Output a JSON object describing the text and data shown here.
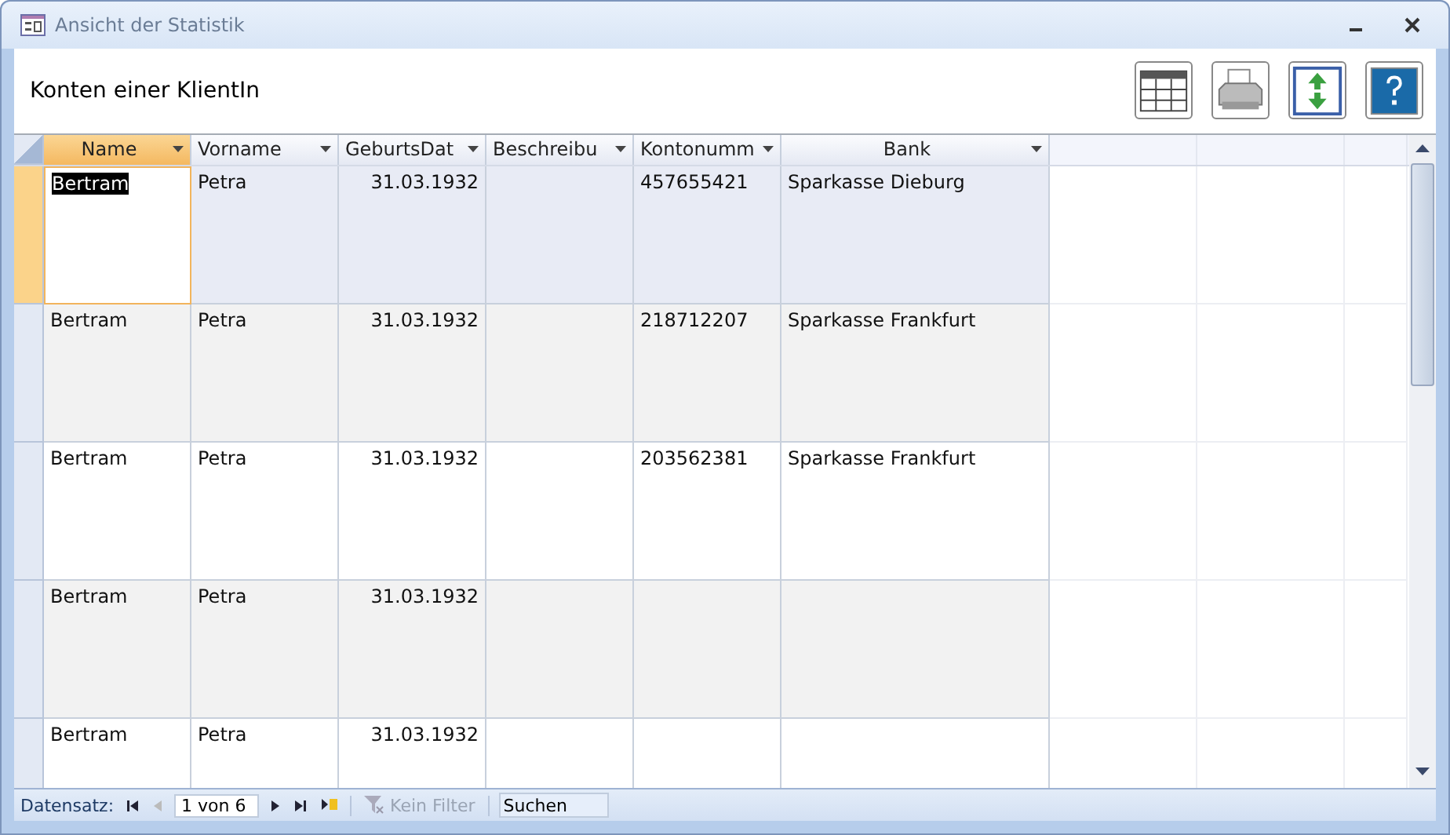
{
  "window": {
    "title": "Ansicht der Statistik"
  },
  "form_title": "Konten einer KlientIn",
  "toolbar": [
    {
      "kind": "table"
    },
    {
      "kind": "print"
    },
    {
      "kind": "updown"
    },
    {
      "kind": "help"
    }
  ],
  "table": {
    "columns": [
      {
        "label": "Name",
        "selected": true,
        "kind": "text"
      },
      {
        "label": "Vorname",
        "selected": false,
        "kind": "text"
      },
      {
        "label": "GeburtsDat",
        "selected": false,
        "kind": "date"
      },
      {
        "label": "Beschreibu",
        "selected": false,
        "kind": "text"
      },
      {
        "label": "Kontonumm",
        "selected": false,
        "kind": "text"
      },
      {
        "label": "Bank",
        "selected": false,
        "kind": "text"
      }
    ],
    "rows": [
      {
        "selected": true,
        "cells": [
          "Bertram",
          "Petra",
          "31.03.1932",
          "",
          "457655421",
          "Sparkasse Dieburg"
        ]
      },
      {
        "selected": false,
        "cells": [
          "Bertram",
          "Petra",
          "31.03.1932",
          "",
          "218712207",
          "Sparkasse Frankfurt"
        ]
      },
      {
        "selected": false,
        "cells": [
          "Bertram",
          "Petra",
          "31.03.1932",
          "",
          "203562381",
          "Sparkasse Frankfurt"
        ]
      },
      {
        "selected": false,
        "cells": [
          "Bertram",
          "Petra",
          "31.03.1932",
          "",
          "",
          ""
        ]
      },
      {
        "selected": false,
        "cells": [
          "Bertram",
          "Petra",
          "31.03.1932",
          "",
          "",
          ""
        ]
      }
    ]
  },
  "status_bar": {
    "label": "Datensatz:",
    "record": "1 von 6",
    "filter": "Kein Filter",
    "filter_disabled": true,
    "search": {
      "placeholder": "Suchen"
    }
  }
}
